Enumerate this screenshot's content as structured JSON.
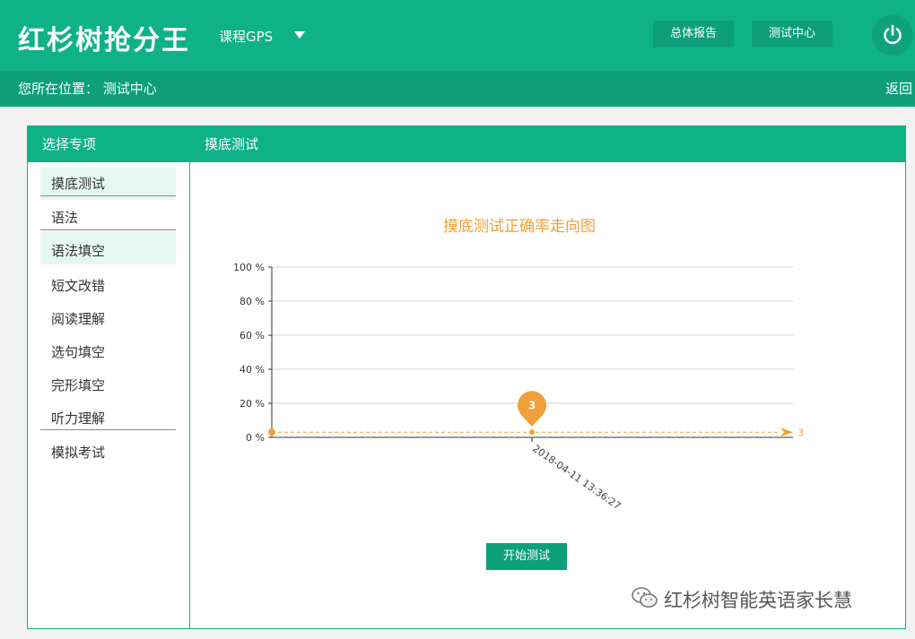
{
  "header": {
    "logo": "红杉树抢分王",
    "course": "课程GPS",
    "report_btn": "总体报告",
    "test_center_btn": "测试中心"
  },
  "breadcrumb": {
    "text": "您所在位置： 测试中心",
    "back": "返回"
  },
  "sidebar": {
    "title": "选择专项",
    "items": [
      {
        "label": "摸底测试"
      },
      {
        "label": "语法"
      },
      {
        "label": "语法填空"
      },
      {
        "label": "短文改错"
      },
      {
        "label": "阅读理解"
      },
      {
        "label": "选句填空"
      },
      {
        "label": "完形填空"
      },
      {
        "label": "听力理解"
      },
      {
        "label": "模拟考试"
      }
    ]
  },
  "main": {
    "title": "摸底测试",
    "start_btn": "开始测试"
  },
  "chart_data": {
    "type": "line",
    "title": "摸底测试正确率走向图",
    "ylim": [
      0,
      100
    ],
    "yticks": [
      "0 %",
      "20 %",
      "40 %",
      "60 %",
      "80 %",
      "100 %"
    ],
    "x": [
      "2018-04-11 13:36:27"
    ],
    "series": [
      {
        "values": [
          3
        ]
      }
    ],
    "markers": {
      "point_label": "3",
      "line_label": "3"
    },
    "grid": true,
    "colors": {
      "series": "#f0a038",
      "title": "#f0a038"
    }
  },
  "watermark": {
    "text": "红杉树智能英语家长慧"
  },
  "colors": {
    "brand": "#0fb287",
    "brand_dark": "#0c9f7a",
    "accent": "#f0a038"
  },
  "icons": {
    "power": "power-icon",
    "caret": "chevron-down-icon",
    "wechat": "wechat-icon"
  }
}
